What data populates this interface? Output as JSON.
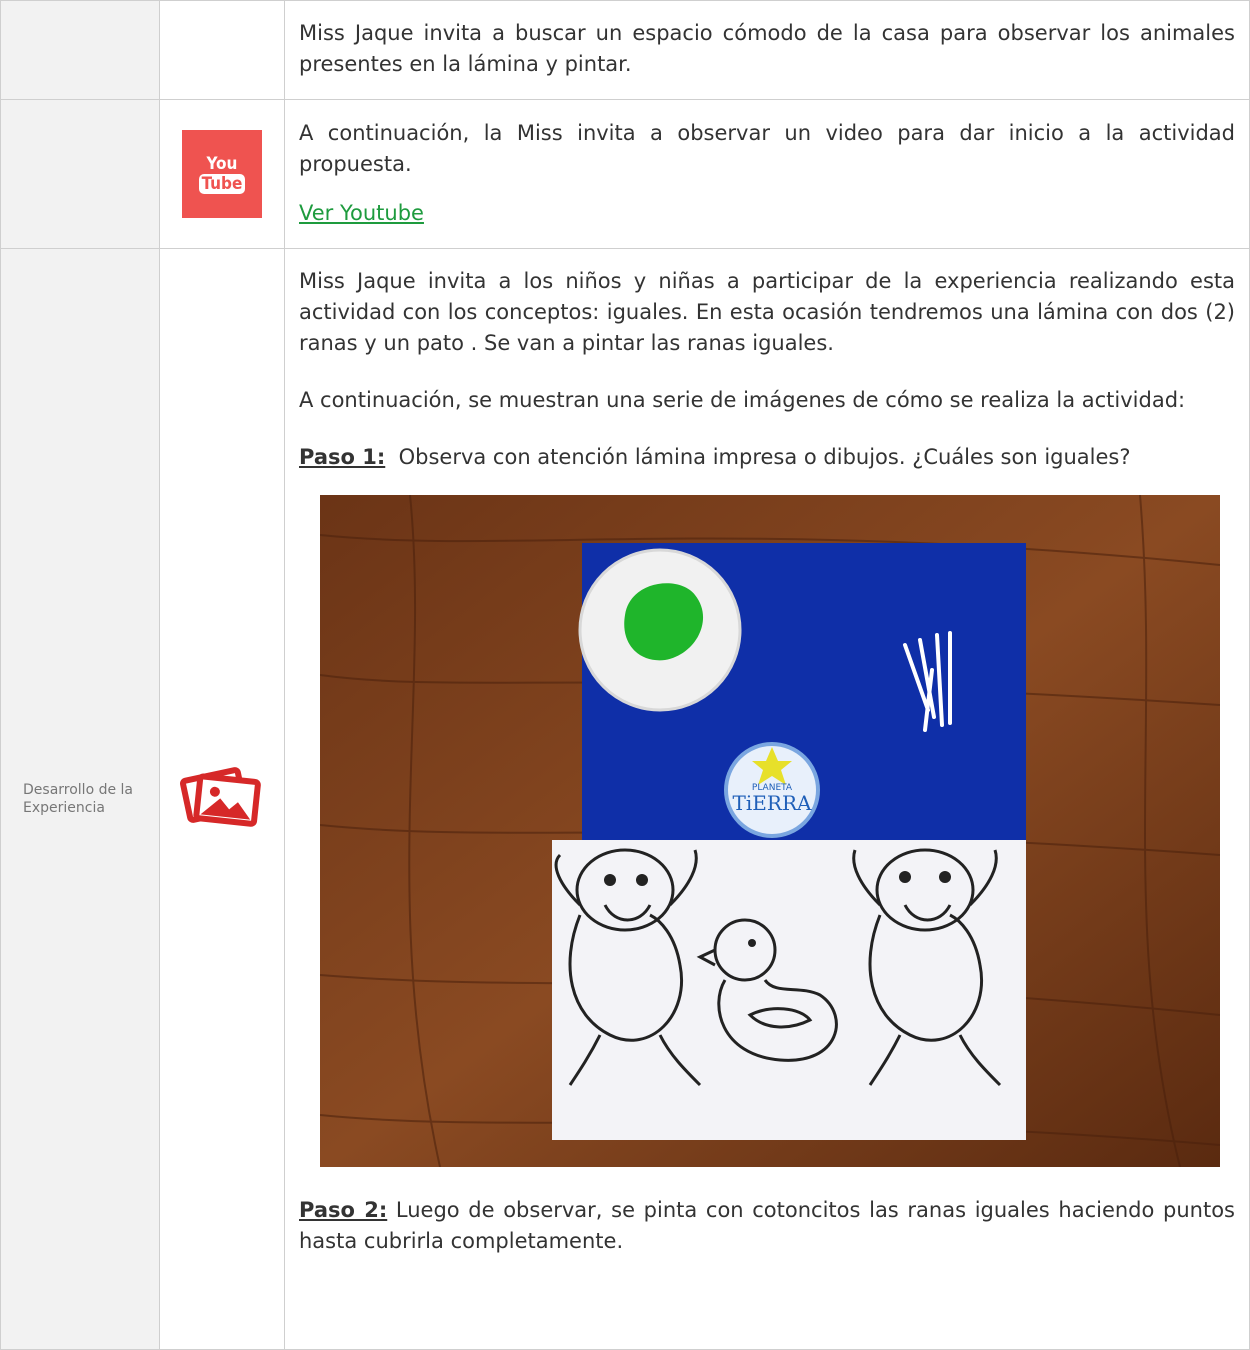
{
  "rows": [
    {
      "label": "",
      "text": "Miss Jaque invita a buscar un espacio cómodo de la casa para observar los animales presentes en la lámina y pintar."
    },
    {
      "label": "",
      "icon": "youtube-icon",
      "icon_text_top": "You",
      "icon_text_bottom": "Tube",
      "text": "A continuación, la Miss invita a observar un video para dar inicio a la actividad propuesta.",
      "link": "Ver Youtube"
    },
    {
      "label": "Desarrollo de la Experiencia",
      "icon": "images-icon",
      "para1": "Miss Jaque invita a los niños y niñas a participar de la experiencia realizando esta actividad con los conceptos: iguales. En esta ocasión tendremos una lámina con dos (2) ranas y un pato . Se van a pintar las ranas iguales.",
      "para2": "A continuación, se muestran una serie de imágenes de cómo se realiza la actividad:",
      "step1_label": "Paso 1:",
      "step1_text": "  Observa con atención lámina impresa o dibujos. ¿Cuáles son iguales?",
      "photo_logo_top": "PLANETA",
      "photo_logo_main": "TiERRA",
      "step2_label": "Paso 2:",
      "step2_text": " Luego de observar, se pinta con cotoncitos las ranas iguales haciendo puntos hasta cubrirla completamente."
    }
  ],
  "colors": {
    "link": "#1e9b3e",
    "youtube": "#ef5350",
    "images_icon": "#d62828"
  }
}
